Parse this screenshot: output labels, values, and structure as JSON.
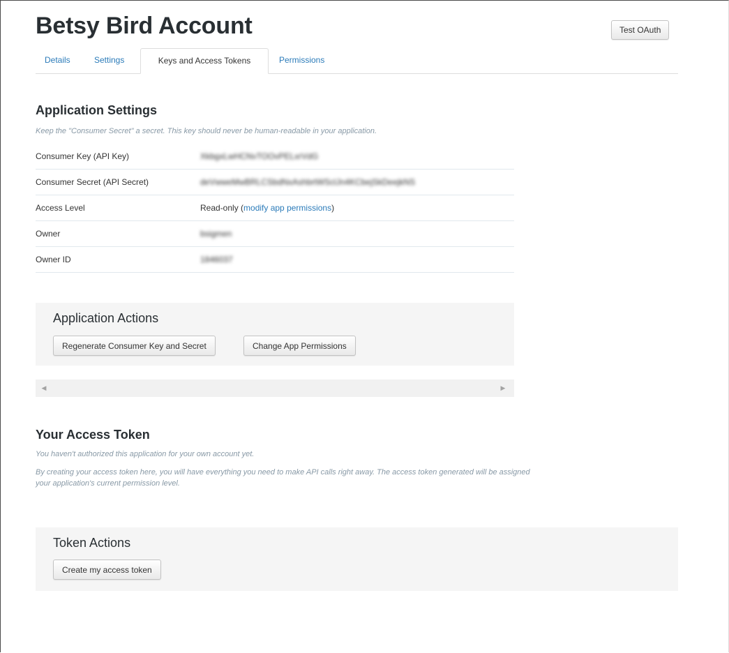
{
  "header": {
    "title": "Betsy Bird Account",
    "test_oauth_label": "Test OAuth"
  },
  "tabs": [
    {
      "label": "Details"
    },
    {
      "label": "Settings"
    },
    {
      "label": "Keys and Access Tokens",
      "active": true
    },
    {
      "label": "Permissions"
    }
  ],
  "app_settings": {
    "heading": "Application Settings",
    "note": "Keep the \"Consumer Secret\" a secret. This key should never be human-readable in your application.",
    "rows": [
      {
        "label": "Consumer Key (API Key)",
        "value": "XkbgxLwHCNvTOOvPELxrVdG"
      },
      {
        "label": "Consumer Secret (API Secret)",
        "value": "deVwweMwBRLCSbdNxAshbrtWSclJn4KCbejSkDeejkNS"
      },
      {
        "label": "Access Level",
        "value_prefix": "Read-only (",
        "value_link": "modify app permissions",
        "value_suffix": ")"
      },
      {
        "label": "Owner",
        "value": "bsigmen"
      },
      {
        "label": "Owner ID",
        "value": "1846037"
      }
    ]
  },
  "app_actions": {
    "heading": "Application Actions",
    "regenerate_label": "Regenerate Consumer Key and Secret",
    "change_permissions_label": "Change App Permissions"
  },
  "access_token": {
    "heading": "Your Access Token",
    "note1": "You haven't authorized this application for your own account yet.",
    "note2_line1": "By creating your access token here, you will have everything you need to make API calls right away. The access token generated will be assigned",
    "note2_line2": "your application's current permission level."
  },
  "token_actions": {
    "heading": "Token Actions",
    "create_label": "Create my access token"
  },
  "icons": {
    "scroll_left": "chevron-left-icon",
    "scroll_right": "chevron-right-icon"
  }
}
